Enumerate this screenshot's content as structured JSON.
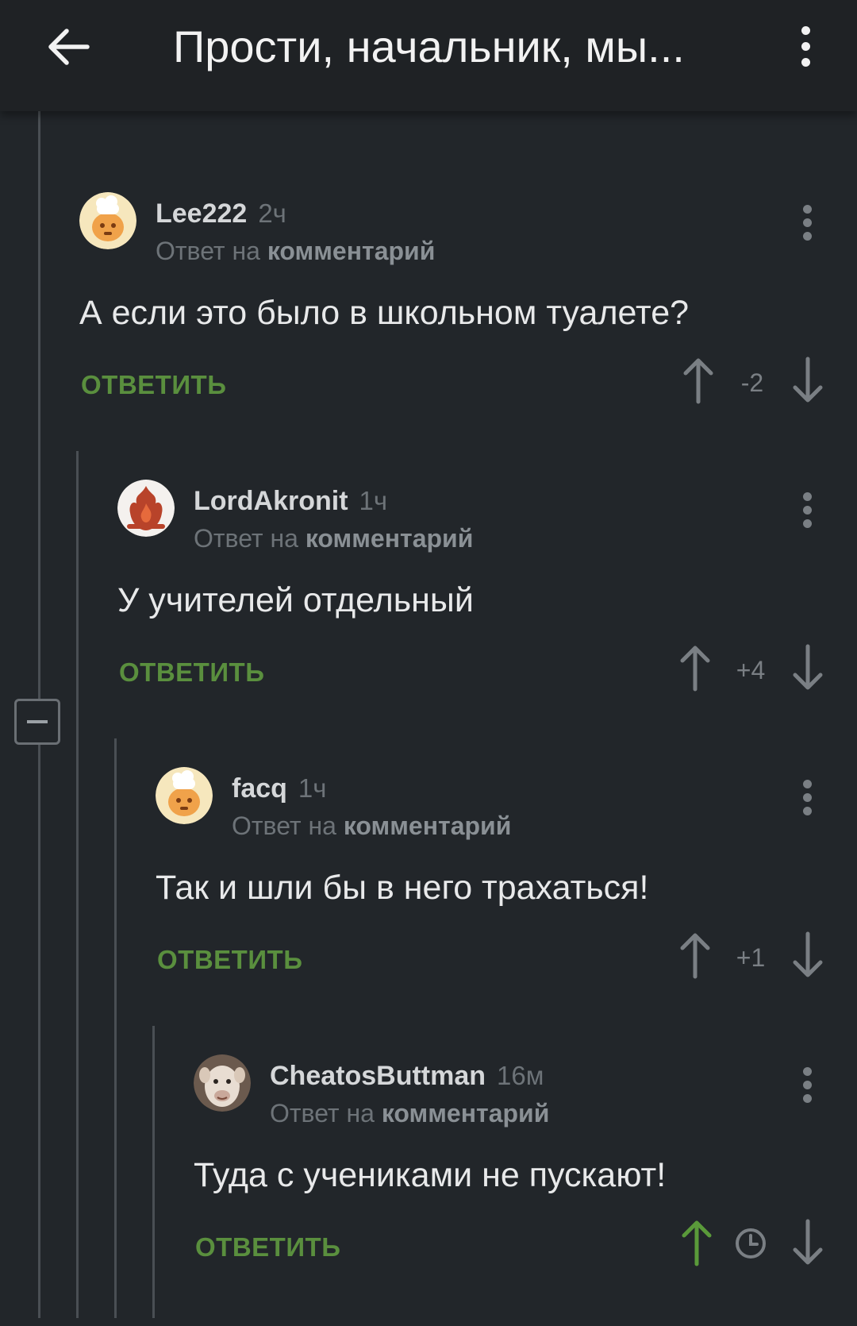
{
  "header": {
    "title": "Прости, начальник, мы..."
  },
  "comments": [
    {
      "author": "Lee222",
      "age": "2ч",
      "reply_to_prefix": "Ответ на",
      "reply_to_target": "комментарий",
      "text": "А если это было в школьном туалете?",
      "reply_label": "ОТВЕТИТЬ",
      "score": "-2",
      "avatar": "chef-hat-avatar"
    },
    {
      "author": "LordAkronit",
      "age": "1ч",
      "reply_to_prefix": "Ответ на",
      "reply_to_target": "комментарий",
      "text": "У учителей отдельный",
      "reply_label": "ОТВЕТИТЬ",
      "score": "+4",
      "avatar": "flame-avatar"
    },
    {
      "author": "facq",
      "age": "1ч",
      "reply_to_prefix": "Ответ на",
      "reply_to_target": "комментарий",
      "text": "Так и шли бы в него трахаться!",
      "reply_label": "ОТВЕТИТЬ",
      "score": "+1",
      "avatar": "chef-hat-avatar"
    },
    {
      "author": "CheatosButtman",
      "age": "16м",
      "reply_to_prefix": "Ответ на",
      "reply_to_target": "комментарий",
      "text": "Туда с учениками не пускают!",
      "reply_label": "ОТВЕТИТЬ",
      "score_icon": "clock-icon",
      "upvoted": true,
      "avatar": "alpaca-photo-avatar"
    }
  ],
  "colors": {
    "background": "#22262a",
    "header": "#1f2225",
    "reply_green": "#5a8f3e",
    "upvote_active": "#5a9a3a",
    "muted": "#7a7f84"
  }
}
